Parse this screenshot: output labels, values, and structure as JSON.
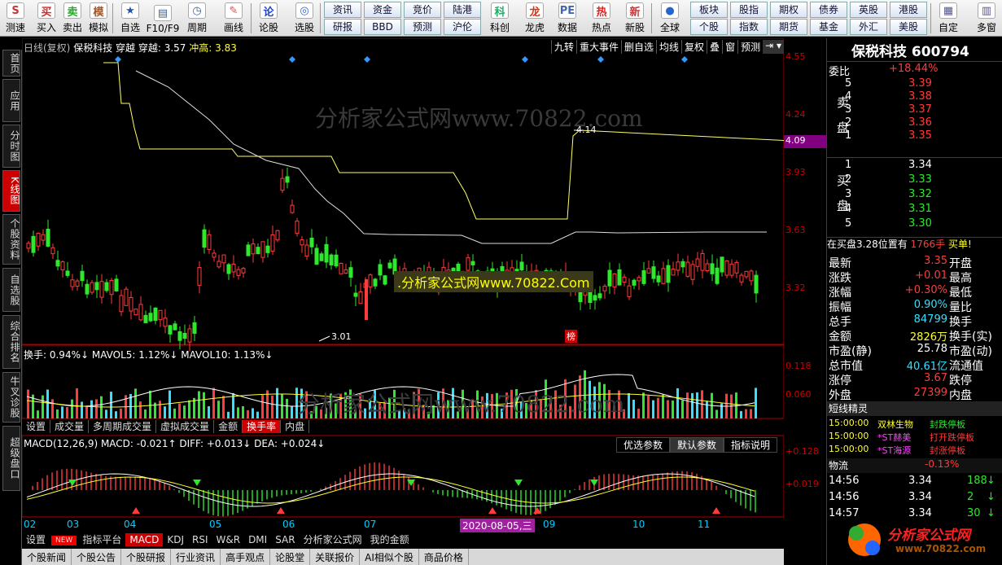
{
  "toolbar": {
    "buttons": [
      {
        "label": "测速",
        "icon": "S"
      },
      {
        "label": "买入",
        "icon": "买"
      },
      {
        "label": "卖出",
        "icon": "卖"
      },
      {
        "label": "模拟",
        "icon": "模"
      },
      {
        "label": "自选",
        "icon": "★"
      },
      {
        "label": "F10/F9",
        "icon": "▤"
      },
      {
        "label": "周期",
        "icon": "◷"
      },
      {
        "label": "画线",
        "icon": "✎"
      },
      {
        "label": "论股",
        "icon": "论"
      },
      {
        "label": "选股",
        "icon": "◎"
      },
      {
        "label": "科创",
        "icon": "科"
      },
      {
        "label": "龙虎",
        "icon": "龙"
      },
      {
        "label": "数据",
        "icon": "PE"
      },
      {
        "label": "热点",
        "icon": "热"
      },
      {
        "label": "新股",
        "icon": "新"
      },
      {
        "label": "全球",
        "icon": "●"
      },
      {
        "label": "自定",
        "icon": "▦"
      },
      {
        "label": "多窗",
        "icon": "▥"
      }
    ],
    "grid1": [
      "资讯",
      "资金",
      "竞价",
      "陆港",
      "研报",
      "BBD",
      "预测",
      "沪伦"
    ],
    "grid2": [
      "板块",
      "股指",
      "期权",
      "债券",
      "英股",
      "港股",
      "个股",
      "指数",
      "期货",
      "基金",
      "外汇",
      "美股"
    ]
  },
  "sidebar": [
    "首页",
    "应用",
    "分时图",
    "K线图",
    "个股资料",
    "自选股",
    "综合排名",
    "牛叉诊股",
    "超级盘口"
  ],
  "chart": {
    "header_name": "日线(复权)",
    "header_stock": "保税科技",
    "header_text": "穿越 穿越: 3.57",
    "header_value": "冲高: 3.83",
    "tools": [
      "九转",
      "重大事件",
      "删自选",
      "均线",
      "复权",
      "叠",
      "窗",
      "预测"
    ],
    "price_labels": [
      "4.55",
      "4.24",
      "3.93",
      "3.63",
      "3.32"
    ],
    "current_marker": "4.09",
    "high_label": "4.14",
    "low_label": "3.01",
    "bang_label": "榜",
    "watermark": "分析家公式网www.70822.com",
    "watermark2": "分析家公式网www.70822.com",
    "promo": ".分析家公式网www.70822.Com",
    "vol_header": "换手: 0.94%↓ MAVOL5: 1.12%↓ MAVOL10: 1.13%↓",
    "vol_labels": [
      "0.118",
      "0.060"
    ],
    "vol_tabs": [
      "设置",
      "成交量",
      "多周期成交量",
      "虚拟成交量",
      "金额",
      "换手率",
      "内盘"
    ],
    "macd_header": "MACD(12,26,9) MACD: -0.021↑ DIFF: +0.013↓ DEA: +0.024↓",
    "macd_buttons": [
      "优选参数",
      "默认参数",
      "指标说明"
    ],
    "macd_labels": [
      "+0.128",
      "+0.019"
    ],
    "months": [
      "02",
      "03",
      "04",
      "05",
      "06",
      "07",
      "08",
      "09",
      "10",
      "11"
    ],
    "date_tag": "2020-08-05,三",
    "bottom_tabs": [
      "设置",
      "NEW",
      "指标平台",
      "MACD",
      "KDJ",
      "RSI",
      "W&R",
      "DMI",
      "SAR",
      "分析家公式网",
      "我的金额"
    ],
    "news_tabs": [
      "个股新闻",
      "个股公告",
      "个股研报",
      "行业资讯",
      "高手观点",
      "论股堂",
      "关联报价",
      "AI相似个股",
      "商品价格"
    ]
  },
  "panel": {
    "title": "保税科技 600794",
    "weibi_label": "委比",
    "weibi_value": "+18.44%",
    "sell_label": "卖盘",
    "buy_label": "买盘",
    "sell": [
      {
        "n": "5",
        "p": "3.39"
      },
      {
        "n": "4",
        "p": "3.38"
      },
      {
        "n": "3",
        "p": "3.37"
      },
      {
        "n": "2",
        "p": "3.36"
      },
      {
        "n": "1",
        "p": "3.35"
      }
    ],
    "buy": [
      {
        "n": "1",
        "p": "3.34"
      },
      {
        "n": "2",
        "p": "3.33"
      },
      {
        "n": "3",
        "p": "3.32"
      },
      {
        "n": "4",
        "p": "3.31"
      },
      {
        "n": "5",
        "p": "3.30"
      }
    ],
    "note_text": "在买盘3.28位置有",
    "note_qty": "1766手",
    "note_act": "买单!",
    "quotes": [
      {
        "l": "最新",
        "v": "3.35",
        "r": "开盘",
        "c": "red"
      },
      {
        "l": "涨跌",
        "v": "+0.01",
        "r": "最高",
        "c": "red"
      },
      {
        "l": "涨幅",
        "v": "+0.30%",
        "r": "最低",
        "c": "red"
      },
      {
        "l": "振幅",
        "v": "0.90%",
        "r": "量比",
        "c": "cyan"
      },
      {
        "l": "总手",
        "v": "84799",
        "r": "换手",
        "c": "cyan"
      },
      {
        "l": "金额",
        "v": "2826万",
        "r": "换手(实)",
        "c": "yel"
      },
      {
        "l": "市盈(静)",
        "v": "25.78",
        "r": "市盈(动)",
        "c": "wht"
      },
      {
        "l": "总市值",
        "v": "40.61亿",
        "r": "流通值",
        "c": "cyan"
      },
      {
        "l": "涨停",
        "v": "3.67",
        "r": "跌停",
        "c": "red"
      },
      {
        "l": "外盘",
        "v": "27399",
        "r": "内盘",
        "c": "red"
      }
    ],
    "elf_title": "短线精灵",
    "elf": [
      {
        "t": "15:00:00",
        "n": "双林生物",
        "e": "封跌停板"
      },
      {
        "t": "15:00:00",
        "n": "*ST赫美",
        "e": "打开跌停板"
      },
      {
        "t": "15:00:00",
        "n": "*ST海源",
        "e": "封涨停板"
      }
    ],
    "flow_label": "物流",
    "flow_value": "-0.13%",
    "ticks": [
      {
        "t": "14:56",
        "p": "3.34",
        "v": "188",
        "d": "↓"
      },
      {
        "t": "14:56",
        "p": "3.34",
        "v": "2",
        "d": "↓"
      },
      {
        "t": "14:57",
        "p": "3.34",
        "v": "30",
        "d": "↓"
      }
    ],
    "logo": "分析家公式网",
    "logo_url": "www.70822.com"
  }
}
